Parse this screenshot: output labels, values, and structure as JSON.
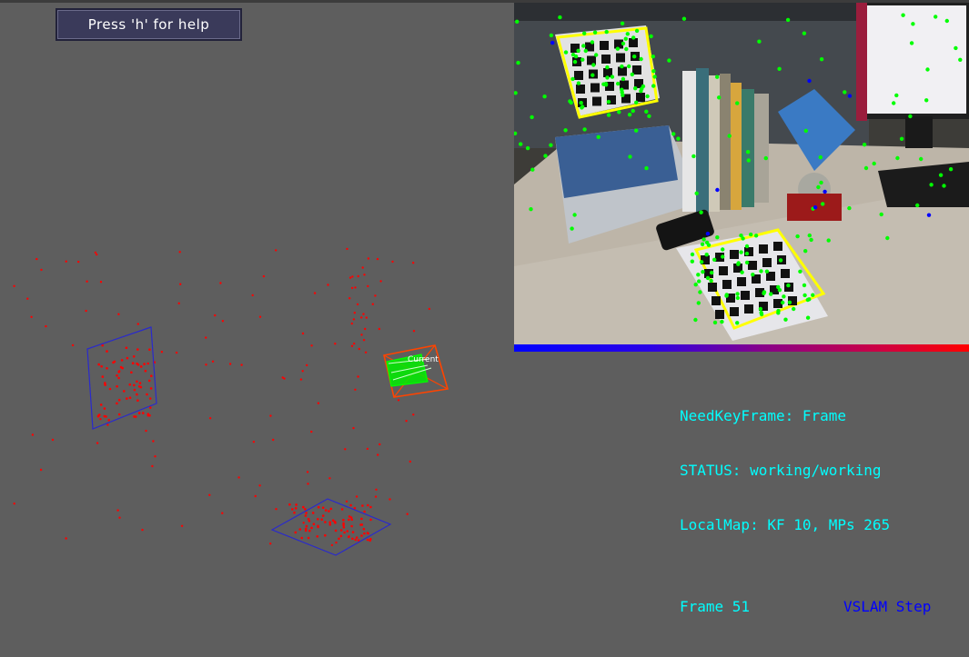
{
  "help_button": {
    "label": "Press 'h' for help"
  },
  "map": {
    "camera_label": "Current",
    "colors": {
      "map_points": "#ff0000",
      "keyframe_planes": "#2a2acc",
      "camera_outline": "#ff4400",
      "camera_trajectory": "#00ff00",
      "background": "#5e5e5e"
    }
  },
  "camera_feed": {
    "feature_color": "#00ff00",
    "marker_outline_color": "#ffff00",
    "depth_bar_colors": [
      "#0000ff",
      "#4400cc",
      "#880088",
      "#cc0044",
      "#ff0000"
    ]
  },
  "status": {
    "need_keyframe": "NeedKeyFrame: Frame",
    "status": "STATUS: working/working",
    "local_map": "LocalMap: KF 10, MPs 265",
    "frame": "Frame 51",
    "mode": "VSLAM Step"
  },
  "colors": {
    "info_text": "#00ffff",
    "mode_text": "#0000ff"
  }
}
